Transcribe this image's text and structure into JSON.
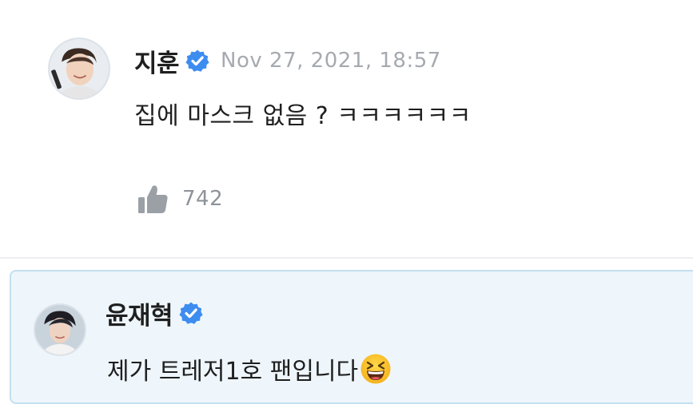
{
  "colors": {
    "verified_badge": "#3d8cf0",
    "timestamp": "#a6aab0",
    "like_icon": "#9aa0a6",
    "reply_background": "#eef6fb",
    "reply_border": "#c3dff0"
  },
  "post": {
    "author": "지훈",
    "verified": true,
    "verified_icon": "verified-badge-icon",
    "timestamp": "Nov 27, 2021, 18:57",
    "text": "집에 마스크 없음 ? ㅋㅋㅋㅋㅋㅋ",
    "like_icon": "thumbs-up-icon",
    "like_count": "742"
  },
  "reply": {
    "author": "윤재혁",
    "verified": true,
    "verified_icon": "verified-badge-icon",
    "text": "제가 트레저1호 팬입니다",
    "emoji": "grinning-squinting-face-emoji"
  }
}
